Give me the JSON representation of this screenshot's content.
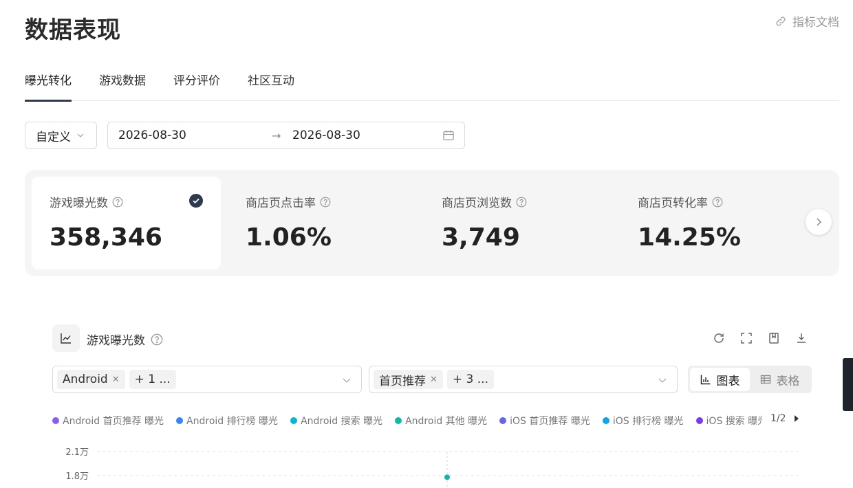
{
  "header": {
    "title": "数据表现",
    "doc_link": "指标文档"
  },
  "tabs": [
    {
      "label": "曝光转化",
      "active": true
    },
    {
      "label": "游戏数据",
      "active": false
    },
    {
      "label": "评分评价",
      "active": false
    },
    {
      "label": "社区互动",
      "active": false
    }
  ],
  "filters": {
    "range_type": "自定义",
    "date_start": "2026-08-30",
    "date_arrow": "→",
    "date_end": "2026-08-30"
  },
  "metrics": [
    {
      "label": "游戏曝光数",
      "value": "358,346",
      "selected": true
    },
    {
      "label": "商店页点击率",
      "value": "1.06%",
      "selected": false
    },
    {
      "label": "商店页浏览数",
      "value": "3,749",
      "selected": false
    },
    {
      "label": "商店页转化率",
      "value": "14.25%",
      "selected": false
    }
  ],
  "chart_panel": {
    "title": "游戏曝光数",
    "platform_filter": {
      "tag": "Android",
      "more": "+ 1 ..."
    },
    "source_filter": {
      "tag": "首页推荐",
      "more": "+ 3 ..."
    },
    "view_toggle": {
      "chart": "图表",
      "table": "表格",
      "active": "chart"
    },
    "legend_pager": "1/2"
  },
  "chart_data": {
    "type": "scatter",
    "series": [
      {
        "name": "Android 首页推荐 曝光",
        "color": "#8b5cf6"
      },
      {
        "name": "Android 排行榜 曝光",
        "color": "#3b82f6"
      },
      {
        "name": "Android 搜索 曝光",
        "color": "#06b6d4"
      },
      {
        "name": "Android 其他 曝光",
        "color": "#14b8a6"
      },
      {
        "name": "iOS 首页推荐 曝光",
        "color": "#6366f1"
      },
      {
        "name": "iOS 排行榜 曝光",
        "color": "#0ea5e9"
      },
      {
        "name": "iOS 搜索 曝光",
        "color": "#7c3aed"
      }
    ],
    "yticks": [
      "2.1万",
      "1.8万"
    ],
    "ytick_values": [
      21000,
      18000
    ],
    "points": [
      {
        "series": "Android 其他 曝光",
        "y": 17800
      }
    ]
  }
}
